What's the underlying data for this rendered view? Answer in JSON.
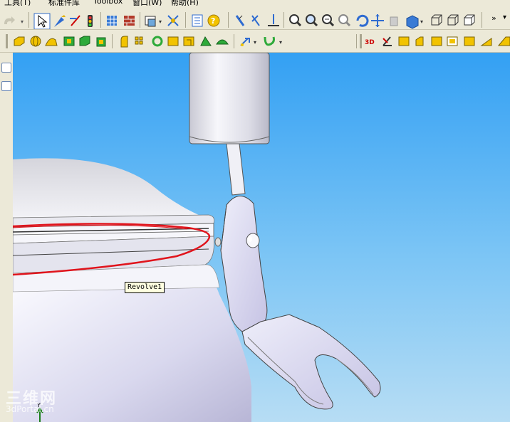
{
  "menubar": {
    "items": [
      "工具(T)",
      "标准件库",
      "Toolbox",
      "窗口(W)",
      "帮助(H)"
    ]
  },
  "toolbar": {
    "overflow_label": "»"
  },
  "viewport": {
    "tooltip": "Revolve1"
  },
  "watermark": {
    "logo_text": "三维网",
    "url_text": "3dPortal.cn"
  },
  "colors": {
    "sky_top": "#33a0f3",
    "sky_bottom": "#b7ddf4",
    "selection_edge": "#e0141c",
    "toolbar_bg": "#ece9d8"
  }
}
